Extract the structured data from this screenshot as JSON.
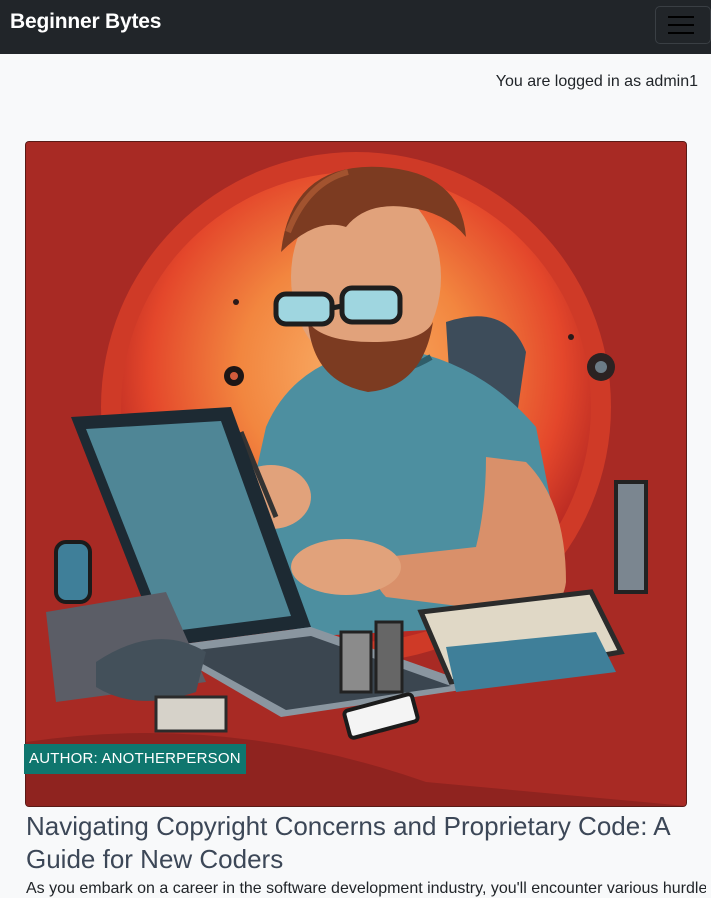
{
  "navbar": {
    "brand": "Beginner Bytes",
    "menu_icon": "hamburger-menu-icon"
  },
  "session": {
    "login_text": "You are logged in as admin1"
  },
  "post": {
    "image_alt": "Illustration of a bearded programmer with glasses typing on a laptop surrounded by electronic gear",
    "author_badge": "AUTHOR: ANOTHERPERSON",
    "title": "Navigating Copyright Concerns and Proprietary Code: A Guide for New Coders",
    "excerpt": "As you embark on a career in the software development industry, you'll encounter various hurdles and"
  },
  "colors": {
    "navbar_bg": "#212529",
    "page_bg": "#f8f9fa",
    "badge_bg": "#0f766e",
    "title_color": "#3c4757",
    "hero_bg": "#a82a24"
  }
}
